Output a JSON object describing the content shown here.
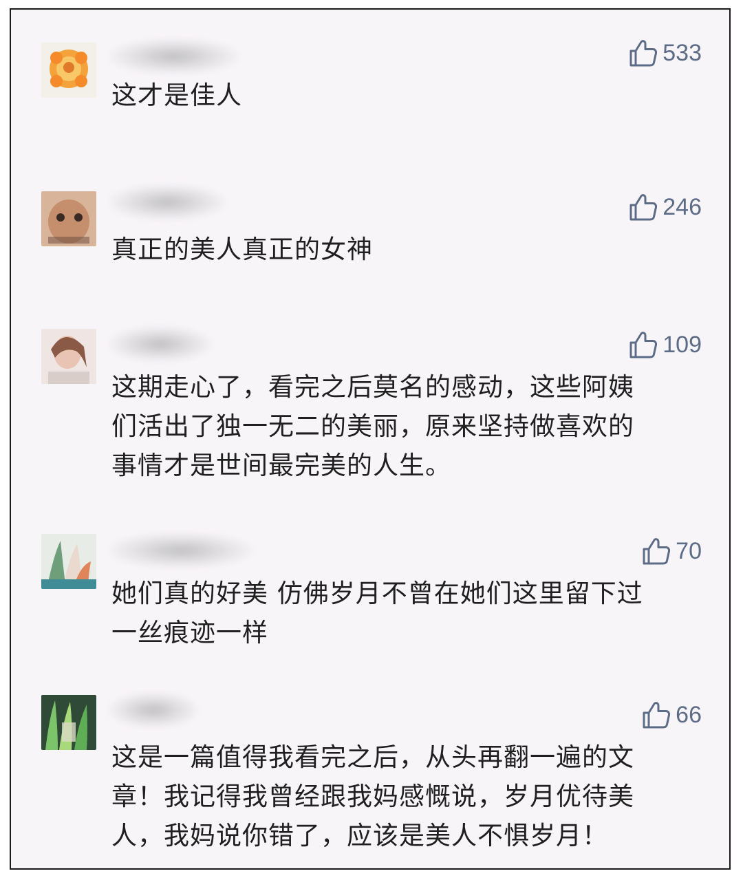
{
  "comments": [
    {
      "likes": "533",
      "text": "这才是佳人"
    },
    {
      "likes": "246",
      "text": "真正的美人真正的女神"
    },
    {
      "likes": "109",
      "text": "这期走心了，看完之后莫名的感动，这些阿姨\n们活出了独一无二的美丽，原来坚持做喜欢的\n事情才是世间最完美的人生。"
    },
    {
      "likes": "70",
      "text": "她们真的好美 仿佛岁月不曾在她们这里留下过\n一丝痕迹一样"
    },
    {
      "likes": "66",
      "text": "这是一篇值得我看完之后，从头再翻一遍的文\n章！我记得我曾经跟我妈感慨说，岁月优待美\n人，我妈说你错了，应该是美人不惧岁月！"
    }
  ],
  "colors": {
    "like_text": "#5d6c86",
    "comment_text": "#1f1f1f",
    "background": "#f8f5f9"
  },
  "icons": {
    "like": "thumbs-up-icon"
  }
}
